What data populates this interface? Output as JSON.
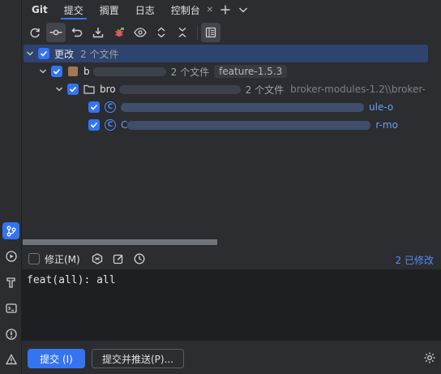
{
  "tabs": {
    "title": "Git",
    "items": [
      {
        "label": "提交",
        "selected": true
      },
      {
        "label": "搁置",
        "selected": false
      },
      {
        "label": "日志",
        "selected": false
      },
      {
        "label": "控制台",
        "selected": false
      }
    ],
    "close_glyph": "✕",
    "add_icon": "plus-icon",
    "more_icon": "chevron-down-icon"
  },
  "toolbar": {
    "icons": [
      "refresh-icon",
      "commit-graph-icon",
      "rollback-icon",
      "download-icon",
      "bug-icon",
      "eye-icon",
      "expand-icon",
      "collapse-icon",
      "preview-panel-icon"
    ]
  },
  "tree": {
    "root": {
      "label": "更改",
      "count": "2 个文件"
    },
    "repo": {
      "label": "b",
      "count": "2 个文件",
      "branch": "feature-1.5.3"
    },
    "module": {
      "label": "bro",
      "count": "2 个文件",
      "tail": "broker-modules-1.2\\\\broker-"
    },
    "files": [
      {
        "label": "",
        "tail": "ule-o"
      },
      {
        "label": "C",
        "tail": "r-mo"
      }
    ]
  },
  "options": {
    "amend_label": "修正(M)",
    "modified": "2 已修改"
  },
  "commit": {
    "message": "feat(all): all",
    "commit_button": "提交 (I)",
    "commit_push_button": "提交并推送(P)..."
  },
  "colors": {
    "accent": "#3574f0",
    "selection": "#2e436e",
    "link": "#548af7"
  }
}
